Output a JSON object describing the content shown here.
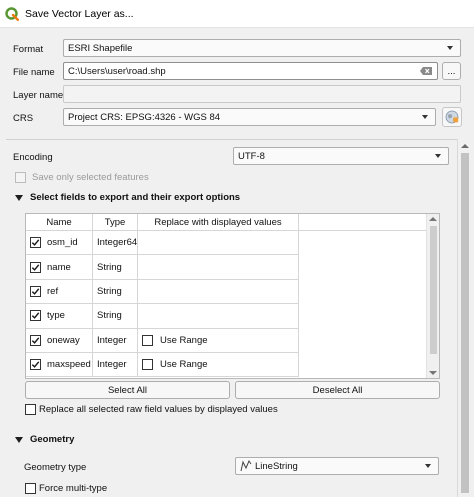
{
  "window": {
    "title": "Save Vector Layer as..."
  },
  "format": {
    "label": "Format",
    "value": "ESRI Shapefile"
  },
  "file_name": {
    "label": "File name",
    "value": "C:\\Users\\user\\road.shp",
    "browse_label": "..."
  },
  "layer_name": {
    "label": "Layer name",
    "value": ""
  },
  "crs": {
    "label": "CRS",
    "value": "Project CRS: EPSG:4326 - WGS 84"
  },
  "encoding": {
    "label": "Encoding",
    "value": "UTF-8"
  },
  "save_only_selected": {
    "label": "Save only selected features",
    "checked": false,
    "enabled": false
  },
  "fields_section": {
    "title": "Select fields to export and their export options",
    "columns": [
      "Name",
      "Type",
      "Replace with displayed values"
    ],
    "rows": [
      {
        "name": "osm_id",
        "type": "Integer64",
        "checked": true,
        "use_range": null
      },
      {
        "name": "name",
        "type": "String",
        "checked": true,
        "use_range": null
      },
      {
        "name": "ref",
        "type": "String",
        "checked": true,
        "use_range": null
      },
      {
        "name": "type",
        "type": "String",
        "checked": true,
        "use_range": null
      },
      {
        "name": "oneway",
        "type": "Integer",
        "checked": true,
        "use_range": "Use Range"
      },
      {
        "name": "maxspeed",
        "type": "Integer",
        "checked": true,
        "use_range": "Use Range"
      }
    ],
    "select_all": "Select All",
    "deselect_all": "Deselect All",
    "replace_all_label": "Replace all selected raw field values by displayed values"
  },
  "geometry_section": {
    "title": "Geometry",
    "geometry_type_label": "Geometry type",
    "geometry_type_value": "LineString",
    "force_multi_label": "Force multi-type"
  },
  "colors": {
    "accent": "#589632",
    "checkmark": "#1a1a1a"
  }
}
